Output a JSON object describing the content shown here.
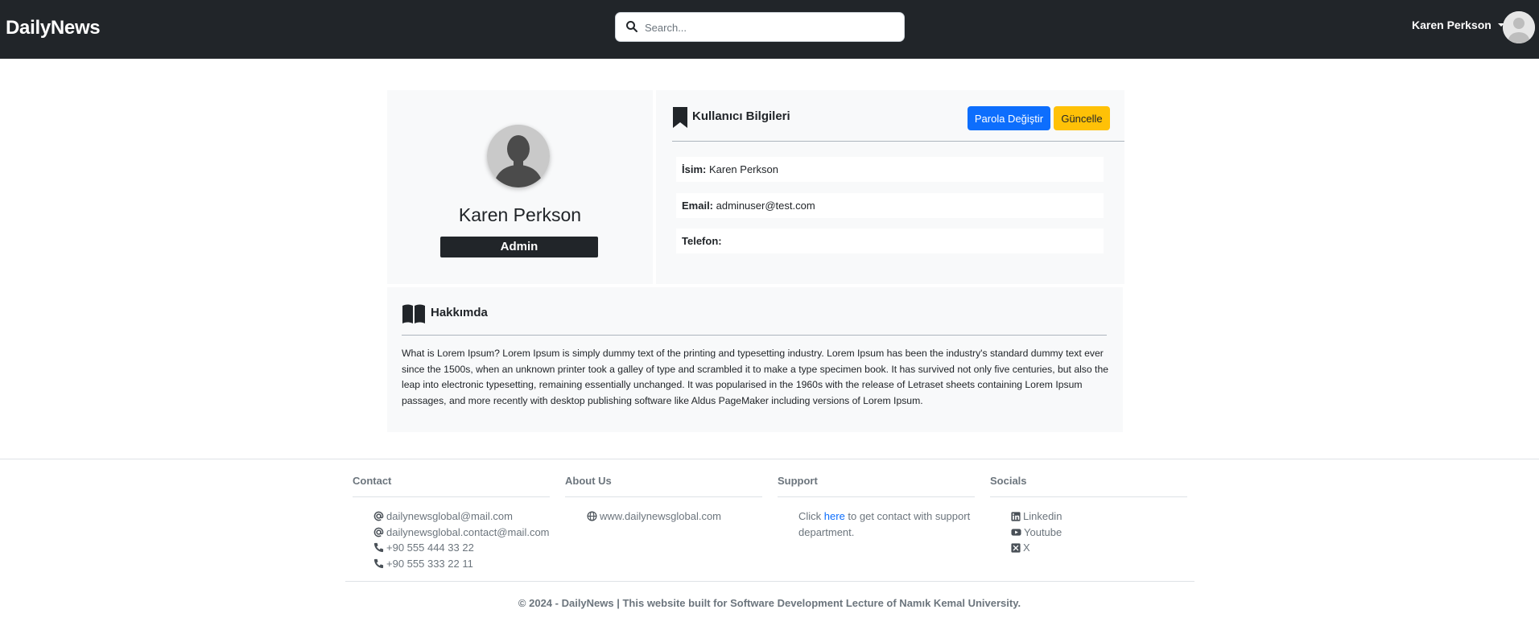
{
  "navbar": {
    "brand": "DailyNews",
    "search_placeholder": "Search...",
    "user_name": "Karen Perkson"
  },
  "profile": {
    "name": "Karen Perkson",
    "role": "Admin"
  },
  "user_info": {
    "title": "Kullanıcı Bilgileri",
    "change_password_label": "Parola Değiştir",
    "update_label": "Güncelle",
    "fields": [
      {
        "label": "İsim:",
        "value": "Karen Perkson"
      },
      {
        "label": "Email:",
        "value": "adminuser@test.com"
      },
      {
        "label": "Telefon:",
        "value": ""
      }
    ]
  },
  "about": {
    "title": "Hakkımda",
    "text": "What is Lorem Ipsum? Lorem Ipsum is simply dummy text of the printing and typesetting industry. Lorem Ipsum has been the industry's standard dummy text ever since the 1500s, when an unknown printer took a galley of type and scrambled it to make a type specimen book. It has survived not only five centuries, but also the leap into electronic typesetting, remaining essentially unchanged. It was popularised in the 1960s with the release of Letraset sheets containing Lorem Ipsum passages, and more recently with desktop publishing software like Aldus PageMaker including versions of Lorem Ipsum."
  },
  "footer": {
    "contact": {
      "title": "Contact",
      "emails": [
        "dailynewsglobal@mail.com",
        "dailynewsglobal.contact@mail.com"
      ],
      "phones": [
        "+90 555 444 33 22",
        "+90 555 333 22 11"
      ]
    },
    "about_us": {
      "title": "About Us",
      "website": "www.dailynewsglobal.com"
    },
    "support": {
      "title": "Support",
      "text_before": "Click ",
      "link_text": "here",
      "text_after": " to get contact with support department."
    },
    "socials": {
      "title": "Socials",
      "items": [
        "Linkedin",
        "Youtube",
        "X"
      ]
    },
    "copyright": "© 2024 - DailyNews | This website built for Software Development Lecture of Namık Kemal University."
  },
  "colors": {
    "navbar_bg": "#212529",
    "card_bg": "#f8f9fa",
    "primary": "#0d6efd",
    "warning": "#ffc107",
    "muted": "#6c757d"
  },
  "icons": {
    "search": "search-icon",
    "avatar": "user-avatar-icon",
    "bookmark": "bookmark-icon",
    "book": "book-open-icon",
    "email": "at-sign-icon",
    "phone": "phone-icon",
    "globe": "globe-icon",
    "linkedin": "linkedin-icon",
    "youtube": "youtube-icon",
    "x": "x-twitter-icon"
  }
}
